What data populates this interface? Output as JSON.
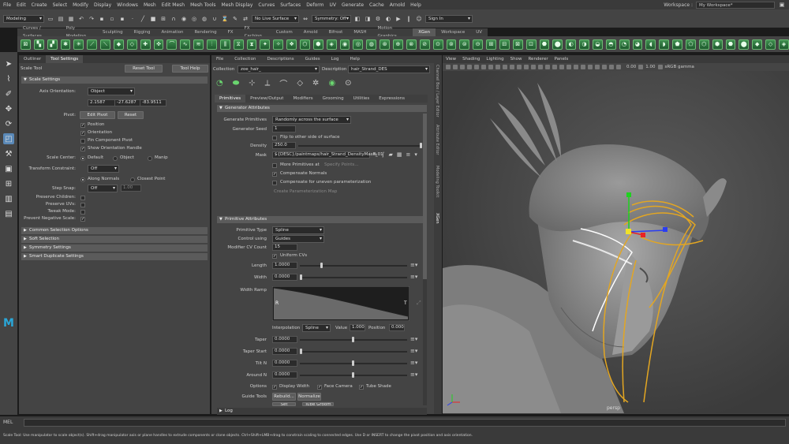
{
  "menu": [
    "File",
    "Edit",
    "Create",
    "Select",
    "Modify",
    "Display",
    "Windows",
    "Mesh",
    "Edit Mesh",
    "Mesh Tools",
    "Mesh Display",
    "Curves",
    "Surfaces",
    "Deform",
    "UV",
    "Generate",
    "Cache",
    "Arnold",
    "Help"
  ],
  "workspace": {
    "label": "Workspace :",
    "value": "My Workspace*"
  },
  "status": {
    "mode": "Modeling",
    "live_surface": "No Live Surface",
    "symmetry": "Symmetry: Off",
    "signin": "Sign In"
  },
  "shelf_tabs": [
    "Curves / Surfaces",
    "Poly Modeling",
    "Sculpting",
    "Rigging",
    "Animation",
    "Rendering",
    "FX",
    "FX Caching",
    "Custom",
    "Arnold",
    "Bifrost",
    "MASH",
    "Motion Graphics",
    "XGen",
    "Workspace",
    "UV"
  ],
  "shelf_active": "XGen",
  "left_tabs": [
    "Outliner",
    "Tool Settings"
  ],
  "tool": {
    "name": "Scale Tool",
    "reset": "Reset Tool",
    "help": "Tool Help"
  },
  "scale": {
    "section": "Scale Settings",
    "axis_label": "Axis Orientation:",
    "axis_value": "Object",
    "xyz": [
      "2.1587",
      "-27.6287",
      "-83.9511"
    ],
    "pivot_label": "Pivot:",
    "edit_pivot": "Edit Pivot",
    "reset": "Reset",
    "pivot_checks": [
      {
        "label": "Position",
        "on": true
      },
      {
        "label": "Orientation",
        "on": true
      },
      {
        "label": "Pin Component Pivot",
        "on": false
      },
      {
        "label": "Show Orientation Handle",
        "on": true
      }
    ],
    "scale_center_label": "Scale Center:",
    "scale_center": [
      "Default",
      "Object",
      "Manip"
    ],
    "transform_label": "Transform Constraint:",
    "transform_value": "Off",
    "along_normals": "Along Normals",
    "closest_point": "Closest Point",
    "snap_label": "Step Snap:",
    "snap_value": "Off",
    "snap_num": "1.00",
    "preserve": [
      "Preserve Children:",
      "Preserve UVs:",
      "Tweak Mode:",
      "Prevent Negative Scale:"
    ],
    "collapsed": [
      "Common Selection Options",
      "Soft Selection",
      "Symmetry Settings",
      "Smart Duplicate Settings"
    ]
  },
  "xgen": {
    "menu": [
      "File",
      "Collection",
      "Descriptions",
      "Guides",
      "Log",
      "Help"
    ],
    "collection_label": "Collection",
    "collection": "zoe_hair_",
    "description_label": "Description",
    "description": "hair_Strand_DES",
    "tabs": [
      "Primitives",
      "Preview/Output",
      "Modifiers",
      "Grooming",
      "Utilities",
      "Expressions"
    ],
    "gen_section": "Generator Attributes",
    "gen_prim_label": "Generate Primitives",
    "gen_prim": "Randomly across the surface",
    "seed_label": "Generator Seed",
    "seed": "1",
    "flip": "Flip to other side of surface",
    "density_label": "Density",
    "density": "250.0",
    "mask_label": "Mask",
    "mask": "${DESC}/paintmaps/hair_Strand_DensityMask_01",
    "more_prims": "More Primitives at",
    "specify": "Specify Points...",
    "comp_normals": "Compensate Normals",
    "comp_uneven": "Compensate for uneven parameterization",
    "create_param": "Create Parameterization Map",
    "prim_section": "Primitive Attributes",
    "ptype_label": "Primitive Type",
    "ptype": "Spline",
    "control_label": "Control using",
    "control": "Guides",
    "cv_label": "Modifier CV Count",
    "cv": "15",
    "uniform": "Uniform CVs",
    "length_label": "Length",
    "length": "1.0000",
    "width_label": "Width",
    "width": "0.0000",
    "ramp_label": "Width Ramp",
    "ramp_r": "R",
    "ramp_t": "T",
    "interp_label": "Interpolation",
    "interp": "Spline",
    "value_label": "Value",
    "value": "1.000",
    "position_label": "Position",
    "position": "0.000",
    "taper_label": "Taper",
    "taper": "0.0000",
    "taper_start_label": "Taper Start",
    "taper_start": "0.0000",
    "tilt_label": "Tilt N",
    "tilt": "0.0000",
    "around_label": "Around N",
    "around": "0.0000",
    "options_label": "Options",
    "options": [
      "Display Width",
      "Face Camera",
      "Tube Shade"
    ],
    "guide_tools_label": "Guide Tools",
    "rebuild": "Rebuild...",
    "normalize": "Normalize",
    "set_length": "Set Length",
    "tube_groom": "Tube Groom",
    "log": "Log"
  },
  "side_strip": [
    "Channel Box / Layer Editor",
    "Attribute Editor",
    "Modeling Toolkit",
    "XGen"
  ],
  "viewport": {
    "menu": [
      "View",
      "Shading",
      "Lighting",
      "Show",
      "Renderer",
      "Panels"
    ],
    "val1": "0.00",
    "val2": "1.00",
    "colorspace": "sRGB gamma",
    "camera": "persp"
  },
  "mel": "MEL",
  "help_line": "Scale Tool: Use manipulator to scale object(s). Shift+drag manipulator axis or plane handles to extrude components or clone objects. Ctrl+Shift+LMB+drag to constrain scaling to connected edges. Use D or INSERT to change the pivot position and axis orientation."
}
